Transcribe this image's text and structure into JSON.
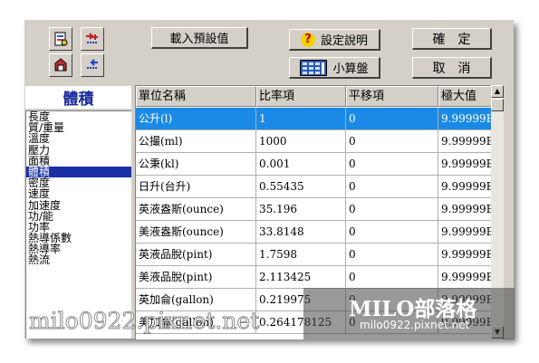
{
  "toolbar": {
    "load_defaults_label": "載入預設值",
    "help_label": "設定說明",
    "calculator_label": "小算盤",
    "ok_label": "確　定",
    "cancel_label": "取　消"
  },
  "category_title": "體積",
  "categories": [
    {
      "label": "長度",
      "selected": false
    },
    {
      "label": "質/重量",
      "selected": false
    },
    {
      "label": "溫度",
      "selected": false
    },
    {
      "label": "壓力",
      "selected": false
    },
    {
      "label": "面積",
      "selected": false
    },
    {
      "label": "體積",
      "selected": true
    },
    {
      "label": "密度",
      "selected": false
    },
    {
      "label": "速度",
      "selected": false
    },
    {
      "label": "加速度",
      "selected": false
    },
    {
      "label": "功/能",
      "selected": false
    },
    {
      "label": "功率",
      "selected": false
    },
    {
      "label": "熱導係數",
      "selected": false
    },
    {
      "label": "熱導率",
      "selected": false
    },
    {
      "label": "熱流",
      "selected": false
    }
  ],
  "table": {
    "columns": [
      "單位名稱",
      "比率項",
      "平移項",
      "極大值"
    ],
    "rows": [
      {
        "name": "公升(l)",
        "ratio": "1",
        "offset": "0",
        "max": "9.99999E",
        "selected": true
      },
      {
        "name": "公撮(ml)",
        "ratio": "1000",
        "offset": "0",
        "max": "9.99999E"
      },
      {
        "name": "公秉(kl)",
        "ratio": "0.001",
        "offset": "0",
        "max": "9.99999E"
      },
      {
        "name": "日升(台升)",
        "ratio": "0.55435",
        "offset": "0",
        "max": "9.99999E"
      },
      {
        "name": "英液盎斯(ounce)",
        "ratio": "35.196",
        "offset": "0",
        "max": "9.99999E"
      },
      {
        "name": "美液盎斯(ounce)",
        "ratio": "33.8148",
        "offset": "0",
        "max": "9.99999E"
      },
      {
        "name": "英液品脫(pint)",
        "ratio": "1.7598",
        "offset": "0",
        "max": "9.99999E"
      },
      {
        "name": "美液品脫(pint)",
        "ratio": "2.113425",
        "offset": "0",
        "max": "9.99999E"
      },
      {
        "name": "英加侖(gallon)",
        "ratio": "0.219975",
        "offset": "0",
        "max": "9.99999E"
      },
      {
        "name": "美加侖(gallon)",
        "ratio": "0.264178125",
        "offset": "0",
        "max": "9.99999E"
      }
    ]
  },
  "watermark": {
    "title": "MILO部落格",
    "url": "milo0922.pixnet.net",
    "big": "milo0922.pixnet.net"
  },
  "colors": {
    "selected_row": "#1a8ae6",
    "selected_category": "#1a2fa3",
    "title_text": "#1a2a9c"
  }
}
